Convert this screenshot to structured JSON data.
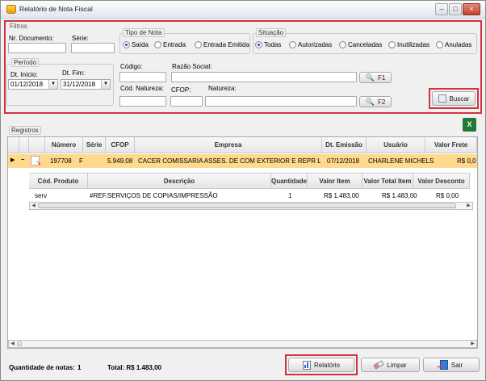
{
  "window": {
    "title": "Relatório de Nota Fiscal",
    "min_glyph": "–",
    "max_glyph": "□",
    "close_glyph": "×"
  },
  "filtros": {
    "title": "Filtros",
    "nr_documento_label": "Nr. Documento:",
    "nr_documento_value": "",
    "serie_label": "Série:",
    "serie_value": "",
    "tipo_nota": {
      "title": "Tipo de Nota",
      "options": [
        "Saída",
        "Entrada",
        "Entrada Emitida"
      ],
      "selected": "Saída"
    },
    "situacao": {
      "title": "Situação",
      "options": [
        "Todas",
        "Autorizadas",
        "Canceladas",
        "Inutilizadas",
        "Anuladas"
      ],
      "selected": "Todas"
    },
    "periodo": {
      "title": "Período",
      "inicio_label": "Dt. Início:",
      "fim_label": "Dt. Fim:",
      "inicio_value": "01/12/2018",
      "fim_value": "31/12/2018"
    },
    "codigo_label": "Código:",
    "razao_social_label": "Razão Social:",
    "cod_natureza_label": "Cód. Natureza:",
    "cfop_label": "CFOP:",
    "natureza_label": "Natureza:",
    "f1_label": "F1",
    "f2_label": "F2",
    "buscar_label": "Buscar"
  },
  "registros": {
    "title": "Registros",
    "columns": [
      "Número",
      "Série",
      "CFOP",
      "Empresa",
      "Dt. Emissão",
      "Usuário",
      "Valor Frete"
    ],
    "row": {
      "numero": "197708",
      "serie": "F",
      "cfop": "5.949.08",
      "empresa": "CACER COMISSARIA ASSES. DE COM EXTERIOR E REPR LT...",
      "dt_emissao": "07/12/2018",
      "usuario": "CHARLENE MICHELS",
      "valor_frete": "R$ 0,0",
      "expand_glyph": "–"
    },
    "detail_columns": [
      "Cód. Produto",
      "Descrição",
      "Quantidade",
      "Valor Item",
      "Valor Total Item",
      "Valor Desconto"
    ],
    "detail_row": {
      "cod_produto": "serv",
      "descricao": "#REF.SERVIÇOS DE COPIAS/IMPRESSÃO",
      "quantidade": "1",
      "valor_item": "R$ 1.483,00",
      "valor_total_item": "R$ 1.483,00",
      "valor_desconto": "R$ 0,00"
    }
  },
  "footer": {
    "quantidade_label": "Quantidade de notas:",
    "quantidade_value": "1",
    "total_label": "Total: R$ 1.483,00",
    "relatorio_label": "Relatório",
    "limpar_label": "Limpar",
    "sair_label": "Sair"
  },
  "colors": {
    "highlight": "#d0333d",
    "selected_row": "#ffd98c",
    "excel_green": "#1f7a3a"
  }
}
